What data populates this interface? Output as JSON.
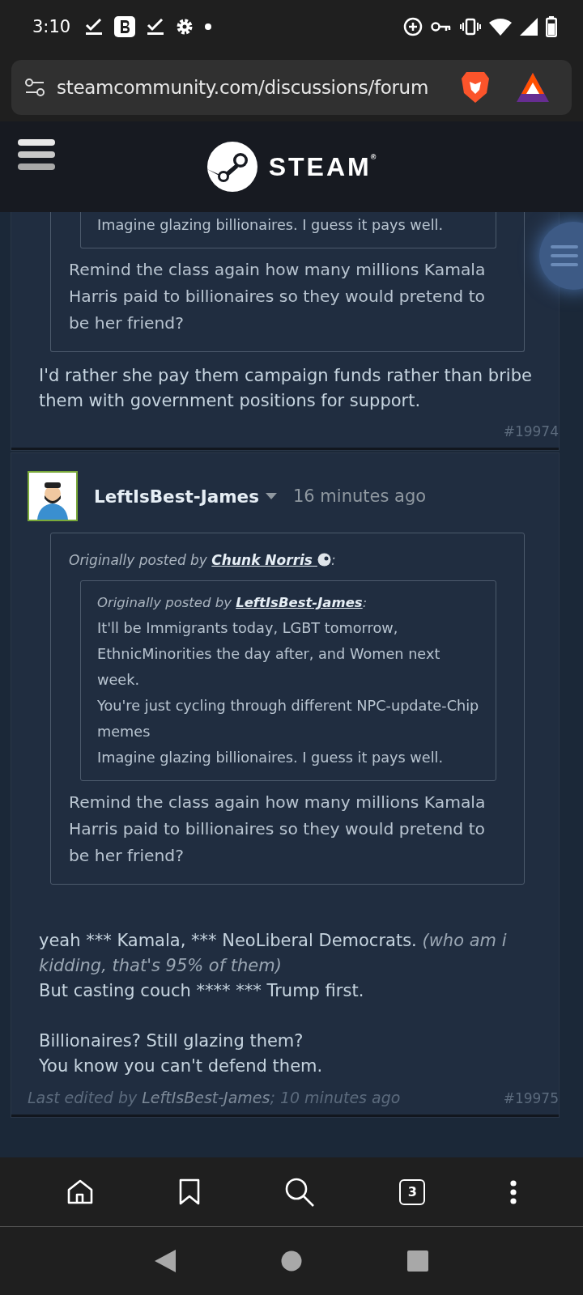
{
  "status_bar": {
    "time": "3:10"
  },
  "address_bar": {
    "url": "steamcommunity.com/discussions/forum"
  },
  "header": {
    "logo_text": "STEAM",
    "trademark": "®"
  },
  "posts": [
    {
      "quote": {
        "quote": {
          "lines": [
            "Imagine glazing billionaires. I guess it pays well."
          ]
        },
        "lines": [
          "Remind the class again how many millions Kamala Harris paid to billionaires so they would pretend to be her friend?"
        ]
      },
      "body": [
        [
          [
            {
              "text": "I'd rather she pay them campaign funds rather than bribe them with government positions for support.",
              "italic": false
            }
          ]
        ]
      ],
      "number": "#19974"
    },
    {
      "author": "LeftIsBest-James",
      "time": "16 minutes ago",
      "quote": {
        "attribution": "Originally posted by",
        "author": "Chunk Norris",
        "suffix": ":",
        "quote": {
          "attribution": "Originally posted by",
          "author": "LeftIsBest-James",
          "suffix": ":",
          "lines": [
            "It'll be Immigrants today, LGBT tomorrow, EthnicMinorities the day after, and Women next week.",
            "You're just cycling through different NPC-update-Chip memes",
            "Imagine glazing billionaires. I guess it pays well."
          ]
        },
        "lines": [
          "Remind the class again how many millions Kamala Harris paid to billionaires so they would pretend to be her friend?"
        ]
      },
      "body": [
        [
          [
            {
              "text": "yeah *** Kamala, *** NeoLiberal Democrats. ",
              "italic": false
            },
            {
              "text": "(who am i kidding, that's 95% of them)",
              "italic": true
            }
          ],
          [
            {
              "text": "But casting couch **** *** Trump first.",
              "italic": false
            }
          ]
        ],
        [
          [
            {
              "text": "Billionaires? Still glazing them?",
              "italic": false
            }
          ],
          [
            {
              "text": "You know you can't defend them.",
              "italic": false
            }
          ]
        ]
      ],
      "edited": {
        "prefix": "Last edited by",
        "author": "LeftIsBest-James",
        "suffix": "; 10 minutes ago"
      },
      "number": "#19975"
    }
  ],
  "bottom_bar": {
    "tab_count": "3"
  }
}
